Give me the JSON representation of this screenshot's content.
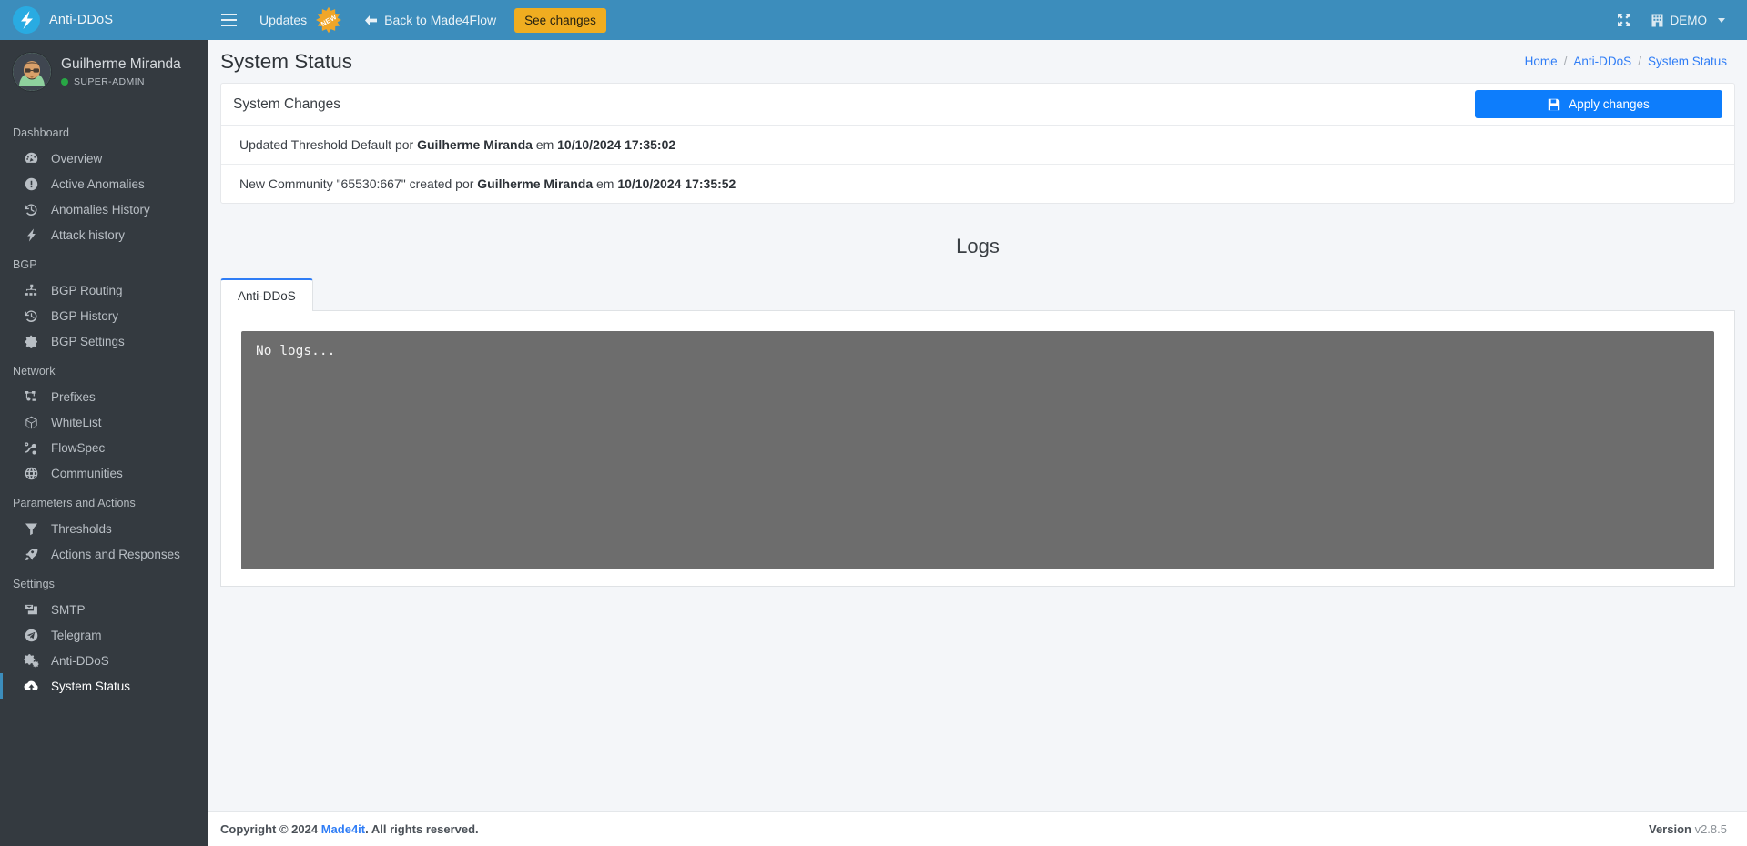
{
  "topbar": {
    "brand_label": "Anti-DDoS",
    "logo_icon": "bolt-logo-icon",
    "menu_toggle_icon": "hamburger-icon",
    "updates_label": "Updates",
    "updates_badge": "NEW",
    "back_label": "Back to Made4Flow",
    "back_icon": "arrow-left-icon",
    "see_changes_label": "See changes",
    "fullscreen_icon": "expand-arrows-icon",
    "company_icon": "building-icon",
    "company_label": "DEMO",
    "caret_icon": "chevron-down-icon",
    "bg_color": "#3c8dbc",
    "accent_yellow": "#f0ad20"
  },
  "sidebar": {
    "user": {
      "name": "Guilherme Miranda",
      "role": "SUPER-ADMIN",
      "status_color": "#28a745",
      "avatar_icon": "user-avatar"
    },
    "sections": [
      {
        "header": "Dashboard",
        "items": [
          {
            "label": "Overview",
            "icon": "tachometer-icon",
            "active": false
          },
          {
            "label": "Active Anomalies",
            "icon": "exclamation-circle-icon",
            "active": false
          },
          {
            "label": "Anomalies History",
            "icon": "history-icon",
            "active": false
          },
          {
            "label": "Attack history",
            "icon": "bolt-icon",
            "active": false
          }
        ]
      },
      {
        "header": "BGP",
        "items": [
          {
            "label": "BGP Routing",
            "icon": "sitemap-icon",
            "active": false
          },
          {
            "label": "BGP History",
            "icon": "history-icon",
            "active": false
          },
          {
            "label": "BGP Settings",
            "icon": "gear-icon",
            "active": false
          }
        ]
      },
      {
        "header": "Network",
        "items": [
          {
            "label": "Prefixes",
            "icon": "project-diagram-icon",
            "active": false
          },
          {
            "label": "WhiteList",
            "icon": "polygon-icon",
            "active": false
          },
          {
            "label": "FlowSpec",
            "icon": "route-icon",
            "active": false
          },
          {
            "label": "Communities",
            "icon": "globe-icon",
            "active": false
          }
        ]
      },
      {
        "header": "Parameters and Actions",
        "items": [
          {
            "label": "Thresholds",
            "icon": "filter-icon",
            "active": false
          },
          {
            "label": "Actions and Responses",
            "icon": "rocket-icon",
            "active": false
          }
        ]
      },
      {
        "header": "Settings",
        "items": [
          {
            "label": "SMTP",
            "icon": "mail-bulk-icon",
            "active": false
          },
          {
            "label": "Telegram",
            "icon": "telegram-icon",
            "active": false
          },
          {
            "label": "Anti-DDoS",
            "icon": "cogs-icon",
            "active": false
          },
          {
            "label": "System Status",
            "icon": "cloud-upload-icon",
            "active": true
          }
        ]
      }
    ]
  },
  "page": {
    "title": "System Status",
    "breadcrumb": [
      {
        "label": "Home"
      },
      {
        "label": "Anti-DDoS"
      },
      {
        "label": "System Status"
      }
    ],
    "breadcrumb_separator": "/"
  },
  "system_changes": {
    "panel_title": "System Changes",
    "apply_button_label": "Apply changes",
    "apply_button_icon": "save-icon",
    "apply_button_color": "#0d7dfc",
    "rows": [
      {
        "prefix": "Updated Threshold Default por ",
        "author": "Guilherme Miranda",
        "middle": " em ",
        "timestamp": "10/10/2024 17:35:02"
      },
      {
        "prefix": "New Community \"65530:667\" created por ",
        "author": "Guilherme Miranda",
        "middle": " em ",
        "timestamp": "10/10/2024 17:35:52"
      }
    ]
  },
  "logs": {
    "title": "Logs",
    "tabs": [
      {
        "label": "Anti-DDoS",
        "active": true
      }
    ],
    "console_text": "No logs..."
  },
  "footer": {
    "copyright_prefix": "Copyright © 2024 ",
    "company": "Made4it",
    "copyright_suffix": ". All rights reserved.",
    "version_label": "Version",
    "version_value": "v2.8.5"
  }
}
